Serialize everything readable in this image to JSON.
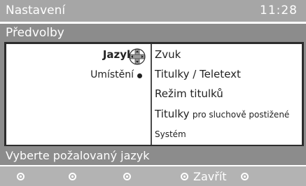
{
  "header": {
    "title": "Nastavení",
    "clock": "11:28"
  },
  "subheader": {
    "title": "Předvolby"
  },
  "left_menu": {
    "items": [
      {
        "label": "Jazyk",
        "selected": true
      },
      {
        "label": "Umístění",
        "selected": false
      }
    ]
  },
  "right_menu": {
    "items": [
      {
        "label": "Zvuk"
      },
      {
        "label": "Titulky / Teletext"
      },
      {
        "label": "Režim titulků"
      },
      {
        "label": "Titulky",
        "label_suffix": "pro sluchově postižené"
      },
      {
        "label": "Systém"
      }
    ]
  },
  "hint": {
    "text": "Vyberte požalovaný jazyk"
  },
  "buttons": {
    "close_label": "Zavřít"
  }
}
